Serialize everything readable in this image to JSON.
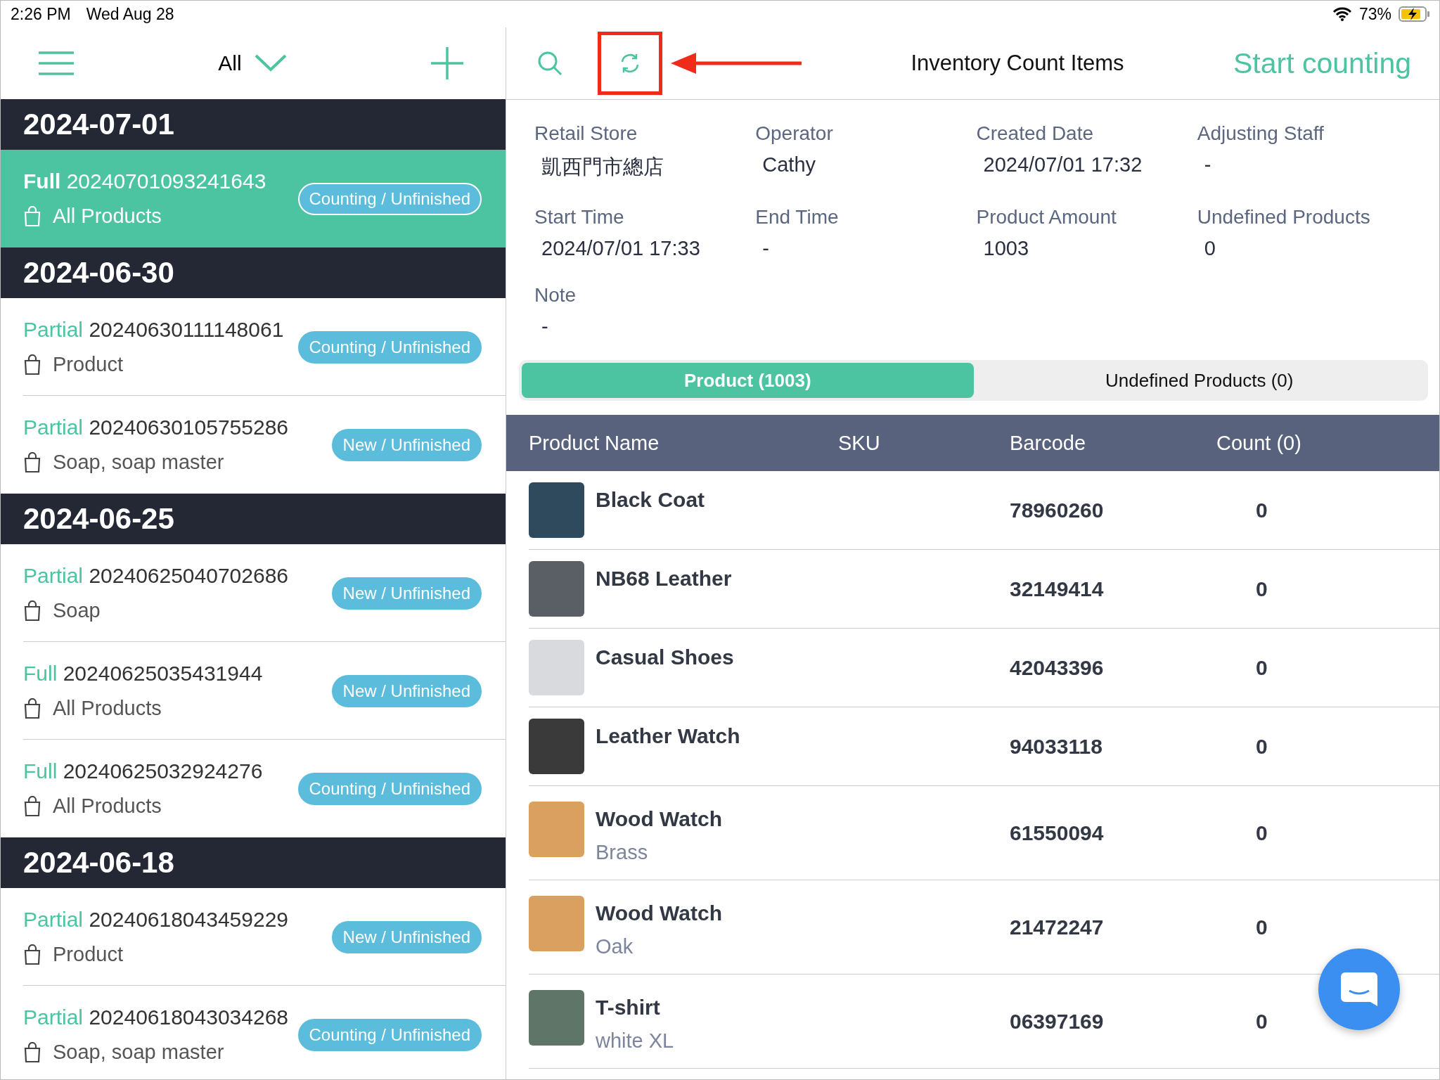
{
  "status_bar": {
    "time": "2:26 PM",
    "date": "Wed Aug 28",
    "battery": "73%"
  },
  "sidebar": {
    "filter": "All",
    "groups": [
      {
        "date": "2024-07-01",
        "records": [
          {
            "type": "Full",
            "number": "20240701093241643",
            "status": "Counting / Unfinished",
            "scope": "All Products",
            "selected": true
          }
        ]
      },
      {
        "date": "2024-06-30",
        "records": [
          {
            "type": "Partial",
            "number": "20240630111148061",
            "status": "Counting / Unfinished",
            "scope": "Product",
            "selected": false
          },
          {
            "type": "Partial",
            "number": "20240630105755286",
            "status": "New / Unfinished",
            "scope": "Soap, soap master",
            "selected": false
          }
        ]
      },
      {
        "date": "2024-06-25",
        "records": [
          {
            "type": "Partial",
            "number": "20240625040702686",
            "status": "New / Unfinished",
            "scope": "Soap",
            "selected": false
          },
          {
            "type": "Full",
            "number": "20240625035431944",
            "status": "New / Unfinished",
            "scope": "All Products",
            "selected": false
          },
          {
            "type": "Full",
            "number": "20240625032924276",
            "status": "Counting / Unfinished",
            "scope": "All Products",
            "selected": false
          }
        ]
      },
      {
        "date": "2024-06-18",
        "records": [
          {
            "type": "Partial",
            "number": "20240618043459229",
            "status": "New / Unfinished",
            "scope": "Product",
            "selected": false
          },
          {
            "type": "Partial",
            "number": "20240618043034268",
            "status": "Counting / Unfinished",
            "scope": "Soap, soap master",
            "selected": false
          }
        ]
      }
    ]
  },
  "header": {
    "title": "Inventory Count Items",
    "action": "Start counting"
  },
  "details": [
    {
      "label": "Retail Store",
      "value": "凱西門市總店"
    },
    {
      "label": "Operator",
      "value": "Cathy"
    },
    {
      "label": "Created Date",
      "value": "2024/07/01 17:32"
    },
    {
      "label": "Adjusting Staff",
      "value": "-"
    },
    {
      "label": "Start Time",
      "value": "2024/07/01 17:33"
    },
    {
      "label": "End Time",
      "value": "-"
    },
    {
      "label": "Product Amount",
      "value": "1003"
    },
    {
      "label": "Undefined Products",
      "value": "0"
    },
    {
      "label": "Note",
      "value": "-"
    }
  ],
  "tabs": [
    {
      "label": "Product (1003)",
      "selected": true
    },
    {
      "label": "Undefined Products (0)",
      "selected": false
    }
  ],
  "table": {
    "columns": [
      "Product Name",
      "SKU",
      "Barcode",
      "Count (0)"
    ],
    "rows": [
      {
        "name": "Black Coat",
        "barcode": "78960260",
        "count": "0",
        "color": "#2f4a5c"
      },
      {
        "name": "NB68 Leather",
        "barcode": "32149414",
        "count": "0",
        "color": "#5a5f66"
      },
      {
        "name": "Casual Shoes",
        "barcode": "42043396",
        "count": "0",
        "color": "#d8dadd"
      },
      {
        "name": "Leather Watch",
        "barcode": "94033118",
        "count": "0",
        "color": "#3a3a3a"
      },
      {
        "name": "Wood Watch",
        "variant": "Brass",
        "barcode": "61550094",
        "count": "0",
        "color": "#d9a060"
      },
      {
        "name": "Wood Watch",
        "variant": "Oak",
        "barcode": "21472247",
        "count": "0",
        "color": "#d9a060"
      },
      {
        "name": "T-shirt",
        "variant": "white XL",
        "barcode": "06397169",
        "count": "0",
        "color": "#5f7567"
      }
    ]
  }
}
